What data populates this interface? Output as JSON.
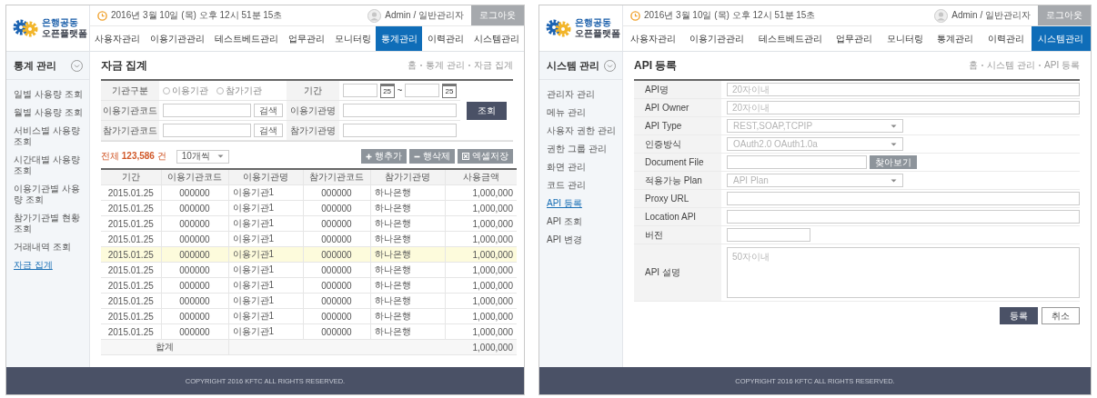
{
  "panels": [
    {
      "kind": "stats",
      "brand": {
        "line1": "은행공동",
        "line2": "오픈플랫폼"
      },
      "datetime": "2016년 3월 10일 (목) 오후 12시 51분 15초",
      "user": "Admin / 일반관리자",
      "logout": "로그아웃",
      "nav": [
        {
          "label": "사용자관리",
          "selected": false
        },
        {
          "label": "이용기관관리",
          "selected": false
        },
        {
          "label": "테스트베드관리",
          "selected": false
        },
        {
          "label": "업무관리",
          "selected": false
        },
        {
          "label": "모니터링",
          "selected": false
        },
        {
          "label": "통계관리",
          "selected": true
        },
        {
          "label": "이력관리",
          "selected": false
        },
        {
          "label": "시스템관리",
          "selected": false
        }
      ],
      "sidebar": {
        "title": "통계 관리",
        "items": [
          {
            "label": "일별 사용량 조회",
            "selected": false
          },
          {
            "label": "월별 사용량 조회",
            "selected": false
          },
          {
            "label": "서비스별 사용량 조회",
            "selected": false
          },
          {
            "label": "시간대별 사용량 조회",
            "selected": false
          },
          {
            "label": "이용기관별 사용량 조회",
            "selected": false
          },
          {
            "label": "참가기관별 현황 조회",
            "selected": false
          },
          {
            "label": "거래내역 조회",
            "selected": false
          },
          {
            "label": "자금 집계",
            "selected": true
          }
        ]
      },
      "page_title": "자금 집계",
      "breadcrumb": [
        "홈",
        "통계 관리",
        "자금 집계"
      ],
      "search_form": {
        "rows": [
          [
            {
              "kind": "radios",
              "label": "기관구분",
              "options": [
                {
                  "label": "이용기관",
                  "checked": false
                },
                {
                  "label": "참가기관",
                  "checked": false
                }
              ]
            },
            {
              "kind": "date_range",
              "label": "기간",
              "separator": "~",
              "dates": [
                {
                  "calendar_day": "25"
                },
                {
                  "calendar_day": "25"
                }
              ]
            }
          ],
          [
            {
              "kind": "code_search",
              "label": "이용기관코드",
              "button": "검색"
            },
            {
              "kind": "text",
              "label": "이용기관명"
            }
          ],
          [
            {
              "kind": "code_search",
              "label": "참가기관코드",
              "button": "검색"
            },
            {
              "kind": "text",
              "label": "참가기관명"
            }
          ]
        ],
        "submit": "조회"
      },
      "total": "전체 **123,586** 건",
      "page_size": "10개씩",
      "actions": [
        {
          "kind": "add",
          "label": "행추가"
        },
        {
          "kind": "remove",
          "label": "행삭제"
        },
        {
          "kind": "export",
          "label": "엑셀저장"
        }
      ],
      "table": {
        "columns": [
          "기간",
          "이용기관코드",
          "이용기관명",
          "참가기관코드",
          "참가기관명",
          "사용금액"
        ],
        "rows": [
          {
            "cells": [
              "2015.01.25",
              "000000",
              "이용기관1",
              "000000",
              "하나은행",
              "1,000,000"
            ],
            "selected": false
          },
          {
            "cells": [
              "2015.01.25",
              "000000",
              "이용기관1",
              "000000",
              "하나은행",
              "1,000,000"
            ],
            "selected": false
          },
          {
            "cells": [
              "2015.01.25",
              "000000",
              "이용기관1",
              "000000",
              "하나은행",
              "1,000,000"
            ],
            "selected": false
          },
          {
            "cells": [
              "2015.01.25",
              "000000",
              "이용기관1",
              "000000",
              "하나은행",
              "1,000,000"
            ],
            "selected": false
          },
          {
            "cells": [
              "2015.01.25",
              "000000",
              "이용기관1",
              "000000",
              "하나은행",
              "1,000,000"
            ],
            "selected": true
          },
          {
            "cells": [
              "2015.01.25",
              "000000",
              "이용기관1",
              "000000",
              "하나은행",
              "1,000,000"
            ],
            "selected": false
          },
          {
            "cells": [
              "2015.01.25",
              "000000",
              "이용기관1",
              "000000",
              "하나은행",
              "1,000,000"
            ],
            "selected": false
          },
          {
            "cells": [
              "2015.01.25",
              "000000",
              "이용기관1",
              "000000",
              "하나은행",
              "1,000,000"
            ],
            "selected": false
          },
          {
            "cells": [
              "2015.01.25",
              "000000",
              "이용기관1",
              "000000",
              "하나은행",
              "1,000,000"
            ],
            "selected": false
          },
          {
            "cells": [
              "2015.01.25",
              "000000",
              "이용기관1",
              "000000",
              "하나은행",
              "1,000,000"
            ],
            "selected": false
          }
        ],
        "summary": {
          "label": "합계",
          "value": "1,000,000"
        }
      },
      "footer": "COPYRIGHT 2016 KFTC ALL RIGHTS RESERVED."
    },
    {
      "kind": "register",
      "brand": {
        "line1": "은행공동",
        "line2": "오픈플랫폼"
      },
      "datetime": "2016년 3월 10일 (목) 오후 12시 51분 15초",
      "user": "Admin / 일반관리자",
      "logout": "로그아웃",
      "nav": [
        {
          "label": "사용자관리",
          "selected": false
        },
        {
          "label": "이용기관관리",
          "selected": false
        },
        {
          "label": "테스트베드관리",
          "selected": false
        },
        {
          "label": "업무관리",
          "selected": false
        },
        {
          "label": "모니터링",
          "selected": false
        },
        {
          "label": "통계관리",
          "selected": false
        },
        {
          "label": "이력관리",
          "selected": false
        },
        {
          "label": "시스템관리",
          "selected": true
        }
      ],
      "sidebar": {
        "title": "시스템 관리",
        "items": [
          {
            "label": "관리자 관리",
            "selected": false
          },
          {
            "label": "메뉴 관리",
            "selected": false
          },
          {
            "label": "사용자 권한 관리",
            "selected": false
          },
          {
            "label": "권한 그룹 관리",
            "selected": false
          },
          {
            "label": "화면 관리",
            "selected": false
          },
          {
            "label": "코드 관리",
            "selected": false
          },
          {
            "label": "API 등록",
            "selected": true
          },
          {
            "label": "API 조회",
            "selected": false
          },
          {
            "label": "API 변경",
            "selected": false
          }
        ]
      },
      "page_title": "API 등록",
      "breadcrumb": [
        "홈",
        "시스템 관리",
        "API 등록"
      ],
      "form": {
        "rows": [
          {
            "kind": "text",
            "label": "API명",
            "placeholder": "20자이내"
          },
          {
            "kind": "text",
            "label": "API Owner",
            "placeholder": "20자이내"
          },
          {
            "kind": "select",
            "label": "API Type",
            "placeholder": "REST,SOAP,TCPIP"
          },
          {
            "kind": "select",
            "label": "인증방식",
            "placeholder": "OAuth2.0 OAuth1.0a"
          },
          {
            "kind": "file",
            "label": "Document File",
            "button": "찾아보기"
          },
          {
            "kind": "select",
            "label": "적용가능 Plan",
            "placeholder": "API Plan"
          },
          {
            "kind": "text",
            "label": "Proxy URL"
          },
          {
            "kind": "text",
            "label": "Location API"
          },
          {
            "kind": "short",
            "label": "버전"
          },
          {
            "kind": "textarea",
            "label": "API 설명",
            "placeholder": "50자이내"
          }
        ]
      },
      "buttons": [
        {
          "kind": "primary",
          "label": "등록"
        },
        {
          "kind": "secondary",
          "label": "취소"
        }
      ],
      "footer": "COPYRIGHT 2016 KFTC ALL RIGHTS RESERVED."
    }
  ]
}
